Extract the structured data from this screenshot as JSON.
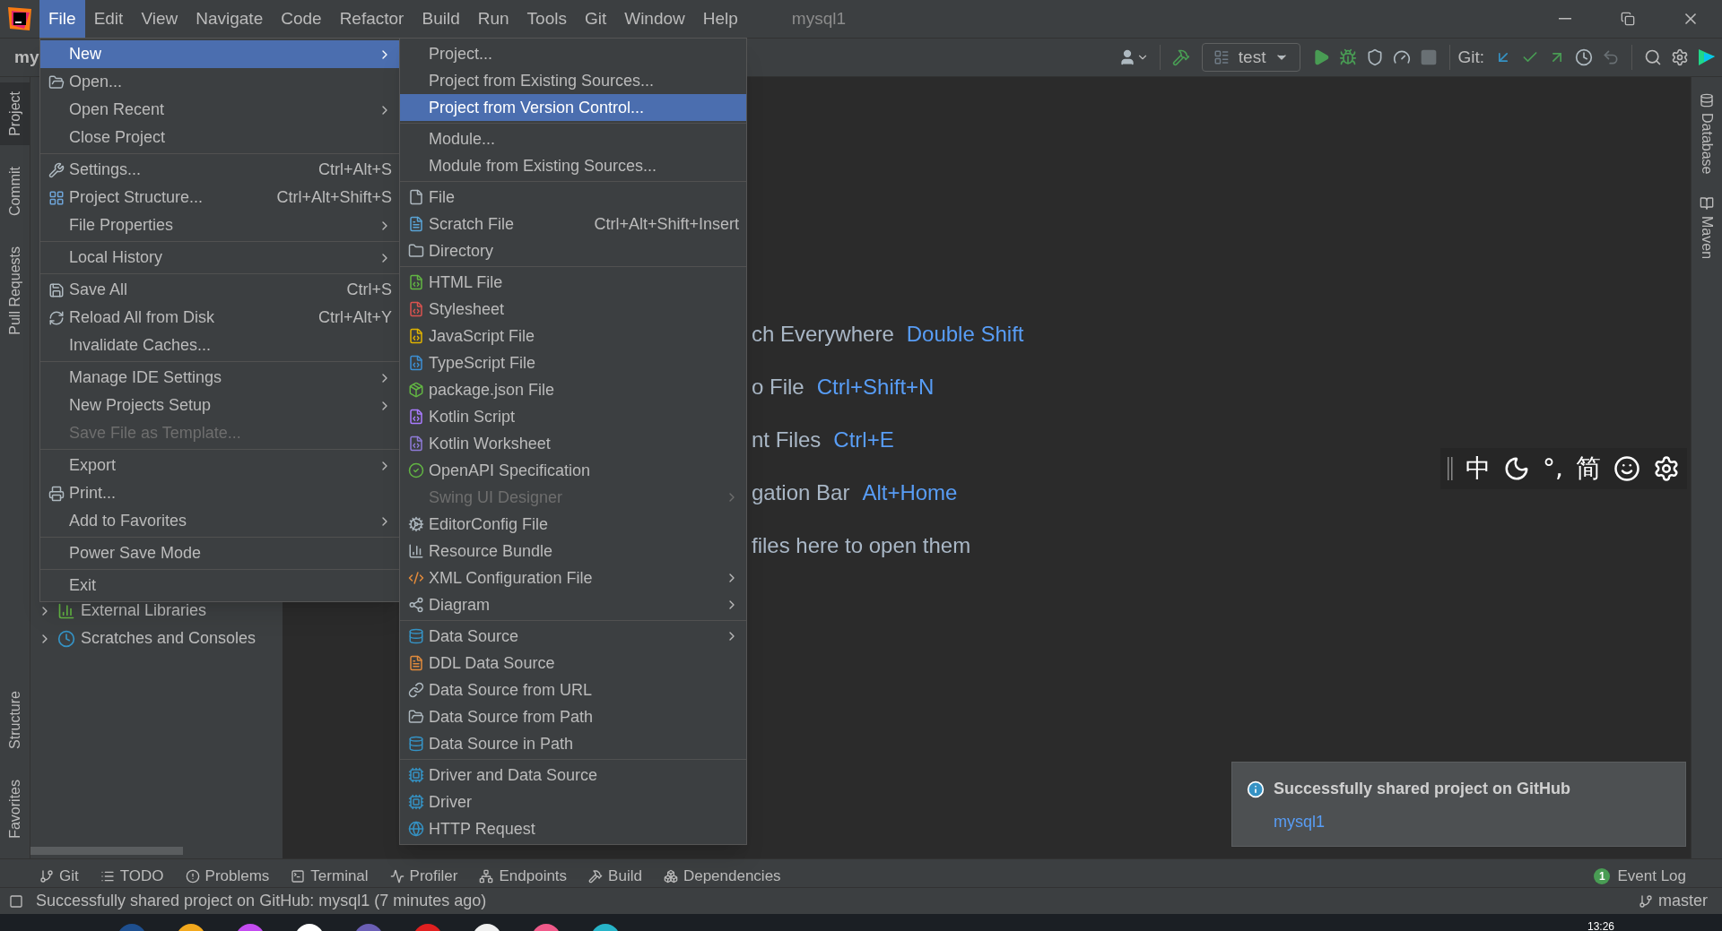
{
  "menu_bar": {
    "items": [
      {
        "label": "File",
        "selected": true
      },
      {
        "label": "Edit",
        "selected": false
      },
      {
        "label": "View",
        "selected": false
      },
      {
        "label": "Navigate",
        "selected": false
      },
      {
        "label": "Code",
        "selected": false
      },
      {
        "label": "Refactor",
        "selected": false
      },
      {
        "label": "Build",
        "selected": false
      },
      {
        "label": "Run",
        "selected": false
      },
      {
        "label": "Tools",
        "selected": false
      },
      {
        "label": "Git",
        "selected": false
      },
      {
        "label": "Window",
        "selected": false
      },
      {
        "label": "Help",
        "selected": false
      }
    ],
    "title": "mysql1"
  },
  "toolbar": {
    "project": "my",
    "run_config": "test",
    "git_label": "Git:",
    "buttons": [
      {
        "kind": "build",
        "disabled": false
      },
      {
        "kind": "run",
        "disabled": false
      },
      {
        "kind": "debug",
        "disabled": false
      },
      {
        "kind": "coverage",
        "disabled": false
      },
      {
        "kind": "profile",
        "disabled": false
      },
      {
        "kind": "stop",
        "disabled": true
      }
    ],
    "git_buttons": [
      {
        "kind": "update",
        "disabled": false
      },
      {
        "kind": "commit",
        "disabled": false
      },
      {
        "kind": "push",
        "disabled": false
      },
      {
        "kind": "history",
        "disabled": false
      },
      {
        "kind": "rollback",
        "disabled": true
      }
    ]
  },
  "left_stripe": [
    {
      "label": "Project",
      "selected": true
    },
    {
      "label": "Commit",
      "selected": false
    },
    {
      "label": "Pull Requests",
      "selected": false
    },
    {
      "label": "Structure",
      "selected": false
    },
    {
      "label": "Favorites",
      "selected": false
    }
  ],
  "right_stripe": [
    {
      "label": "Database",
      "selected": false
    },
    {
      "label": "Maven",
      "selected": false
    }
  ],
  "project_tree": [
    {
      "label": "External Libraries",
      "expanded": false
    },
    {
      "label": "Scratches and Consoles",
      "expanded": false
    }
  ],
  "editor_hints": [
    {
      "text": "ch Everywhere",
      "shortcut": "Double Shift"
    },
    {
      "text": "o File",
      "shortcut": "Ctrl+Shift+N"
    },
    {
      "text": "nt Files",
      "shortcut": "Ctrl+E"
    },
    {
      "text": "gation Bar",
      "shortcut": "Alt+Home"
    },
    {
      "text": "files here to open them"
    }
  ],
  "ime_toolbar": [
    {
      "kind": "handle"
    },
    {
      "kind": "text",
      "text": "中"
    },
    {
      "kind": "moon"
    },
    {
      "kind": "text",
      "text": "°,"
    },
    {
      "kind": "text",
      "text": "简"
    },
    {
      "kind": "smiley"
    },
    {
      "kind": "gear"
    }
  ],
  "notification": {
    "title": "Successfully shared project on GitHub",
    "link": "mysql1"
  },
  "file_menu": [
    {
      "kind": "item",
      "label": "New",
      "submenu": true,
      "selected": true,
      "disabled": false
    },
    {
      "kind": "item",
      "label": "Open...",
      "submenu": false,
      "selected": false,
      "disabled": false
    },
    {
      "kind": "item",
      "label": "Open Recent",
      "submenu": true,
      "selected": false,
      "disabled": false
    },
    {
      "kind": "item",
      "label": "Close Project",
      "submenu": false,
      "selected": false,
      "disabled": false
    },
    {
      "kind": "separator"
    },
    {
      "kind": "item",
      "label": "Settings...",
      "shortcut": "Ctrl+Alt+S",
      "submenu": false,
      "selected": false,
      "disabled": false
    },
    {
      "kind": "item",
      "label": "Project Structure...",
      "shortcut": "Ctrl+Alt+Shift+S",
      "submenu": false,
      "selected": false,
      "disabled": false
    },
    {
      "kind": "item",
      "label": "File Properties",
      "submenu": true,
      "selected": false,
      "disabled": false
    },
    {
      "kind": "separator"
    },
    {
      "kind": "item",
      "label": "Local History",
      "submenu": true,
      "selected": false,
      "disabled": false
    },
    {
      "kind": "separator"
    },
    {
      "kind": "item",
      "label": "Save All",
      "shortcut": "Ctrl+S",
      "submenu": false,
      "selected": false,
      "disabled": false
    },
    {
      "kind": "item",
      "label": "Reload All from Disk",
      "shortcut": "Ctrl+Alt+Y",
      "submenu": false,
      "selected": false,
      "disabled": false
    },
    {
      "kind": "item",
      "label": "Invalidate Caches...",
      "submenu": false,
      "selected": false,
      "disabled": false
    },
    {
      "kind": "separator"
    },
    {
      "kind": "item",
      "label": "Manage IDE Settings",
      "submenu": true,
      "selected": false,
      "disabled": false
    },
    {
      "kind": "item",
      "label": "New Projects Setup",
      "submenu": true,
      "selected": false,
      "disabled": false
    },
    {
      "kind": "item",
      "label": "Save File as Template...",
      "submenu": false,
      "selected": false,
      "disabled": true
    },
    {
      "kind": "separator"
    },
    {
      "kind": "item",
      "label": "Export",
      "submenu": true,
      "selected": false,
      "disabled": false
    },
    {
      "kind": "item",
      "label": "Print...",
      "submenu": false,
      "selected": false,
      "disabled": false
    },
    {
      "kind": "item",
      "label": "Add to Favorites",
      "submenu": true,
      "selected": false,
      "disabled": false
    },
    {
      "kind": "separator"
    },
    {
      "kind": "item",
      "label": "Power Save Mode",
      "submenu": false,
      "selected": false,
      "disabled": false
    },
    {
      "kind": "separator"
    },
    {
      "kind": "item",
      "label": "Exit",
      "submenu": false,
      "selected": false,
      "disabled": false
    }
  ],
  "new_submenu": [
    {
      "kind": "item",
      "label": "Project...",
      "submenu": false,
      "selected": false,
      "disabled": false
    },
    {
      "kind": "item",
      "label": "Project from Existing Sources...",
      "submenu": false,
      "selected": false,
      "disabled": false
    },
    {
      "kind": "item",
      "label": "Project from Version Control...",
      "submenu": false,
      "selected": true,
      "disabled": false
    },
    {
      "kind": "separator"
    },
    {
      "kind": "item",
      "label": "Module...",
      "submenu": false,
      "selected": false,
      "disabled": false
    },
    {
      "kind": "item",
      "label": "Module from Existing Sources...",
      "submenu": false,
      "selected": false,
      "disabled": false
    },
    {
      "kind": "separator"
    },
    {
      "kind": "item",
      "label": "File",
      "submenu": false,
      "selected": false,
      "disabled": false
    },
    {
      "kind": "item",
      "label": "Scratch File",
      "shortcut": "Ctrl+Alt+Shift+Insert",
      "submenu": false,
      "selected": false,
      "disabled": false
    },
    {
      "kind": "item",
      "label": "Directory",
      "submenu": false,
      "selected": false,
      "disabled": false
    },
    {
      "kind": "separator"
    },
    {
      "kind": "item",
      "label": "HTML File",
      "submenu": false,
      "selected": false,
      "disabled": false
    },
    {
      "kind": "item",
      "label": "Stylesheet",
      "submenu": false,
      "selected": false,
      "disabled": false
    },
    {
      "kind": "item",
      "label": "JavaScript File",
      "submenu": false,
      "selected": false,
      "disabled": false
    },
    {
      "kind": "item",
      "label": "TypeScript File",
      "submenu": false,
      "selected": false,
      "disabled": false
    },
    {
      "kind": "item",
      "label": "package.json File",
      "submenu": false,
      "selected": false,
      "disabled": false
    },
    {
      "kind": "item",
      "label": "Kotlin Script",
      "submenu": false,
      "selected": false,
      "disabled": false
    },
    {
      "kind": "item",
      "label": "Kotlin Worksheet",
      "submenu": false,
      "selected": false,
      "disabled": false
    },
    {
      "kind": "item",
      "label": "OpenAPI Specification",
      "submenu": false,
      "selected": false,
      "disabled": false
    },
    {
      "kind": "item",
      "label": "Swing UI Designer",
      "submenu": true,
      "selected": false,
      "disabled": true
    },
    {
      "kind": "item",
      "label": "EditorConfig File",
      "submenu": false,
      "selected": false,
      "disabled": false
    },
    {
      "kind": "item",
      "label": "Resource Bundle",
      "submenu": false,
      "selected": false,
      "disabled": false
    },
    {
      "kind": "item",
      "label": "XML Configuration File",
      "submenu": true,
      "selected": false,
      "disabled": false
    },
    {
      "kind": "item",
      "label": "Diagram",
      "submenu": true,
      "selected": false,
      "disabled": false
    },
    {
      "kind": "separator"
    },
    {
      "kind": "item",
      "label": "Data Source",
      "submenu": true,
      "selected": false,
      "disabled": false
    },
    {
      "kind": "item",
      "label": "DDL Data Source",
      "submenu": false,
      "selected": false,
      "disabled": false
    },
    {
      "kind": "item",
      "label": "Data Source from URL",
      "submenu": false,
      "selected": false,
      "disabled": false
    },
    {
      "kind": "item",
      "label": "Data Source from Path",
      "submenu": false,
      "selected": false,
      "disabled": false
    },
    {
      "kind": "item",
      "label": "Data Source in Path",
      "submenu": false,
      "selected": false,
      "disabled": false
    },
    {
      "kind": "separator"
    },
    {
      "kind": "item",
      "label": "Driver and Data Source",
      "submenu": false,
      "selected": false,
      "disabled": false
    },
    {
      "kind": "item",
      "label": "Driver",
      "submenu": false,
      "selected": false,
      "disabled": false
    },
    {
      "kind": "item",
      "label": "HTTP Request",
      "submenu": false,
      "selected": false,
      "disabled": false
    }
  ],
  "tool_windows_bar": {
    "left": [
      {
        "kind": "git",
        "label": "Git"
      },
      {
        "kind": "todo",
        "label": "TODO"
      },
      {
        "kind": "problems",
        "label": "Problems"
      },
      {
        "kind": "terminal",
        "label": "Terminal"
      },
      {
        "kind": "profiler",
        "label": "Profiler"
      },
      {
        "kind": "endpoints",
        "label": "Endpoints"
      },
      {
        "kind": "build",
        "label": "Build"
      },
      {
        "kind": "dependencies",
        "label": "Dependencies"
      }
    ],
    "right": [
      {
        "label": "Event Log",
        "badge": "1"
      }
    ]
  },
  "status_bar": {
    "message": "Successfully shared project on GitHub: mysql1 (7 minutes ago)",
    "branch": "master"
  },
  "taskbar": {
    "time": "13:26"
  }
}
